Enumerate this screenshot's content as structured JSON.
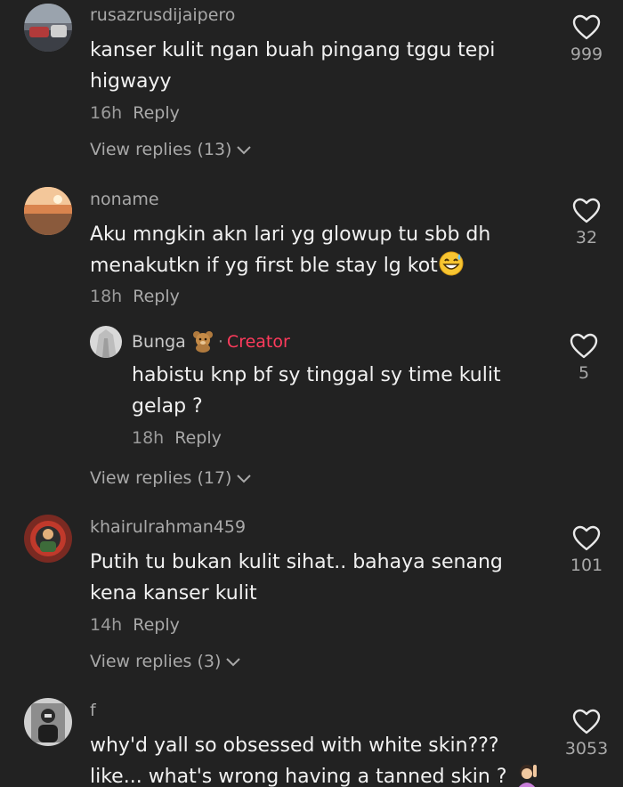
{
  "comments": [
    {
      "username": "rusazrusdijaipero",
      "lines": [
        "kanser kulit ngan buah pingang tggu tepi",
        "higwayy"
      ],
      "time": "16h",
      "reply_label": "Reply",
      "likes": "999",
      "view_replies": "View replies (13)"
    },
    {
      "username": "noname",
      "lines": [
        "Aku mngkin akn lari yg glowup tu sbb dh",
        "menakutkn if yg first ble stay lg kot"
      ],
      "time": "18h",
      "reply_label": "Reply",
      "likes": "32",
      "reply": {
        "username": "Bunga",
        "creator_sep": "·",
        "creator_label": "Creator",
        "lines": [
          "habistu knp bf sy tinggal sy time kulit",
          "gelap ?"
        ],
        "time": "18h",
        "reply_label": "Reply",
        "likes": "5"
      },
      "view_replies": "View replies (17)"
    },
    {
      "username": "khairulrahman459",
      "lines": [
        "Putih tu bukan kulit sihat.. bahaya senang",
        "kena kanser kulit"
      ],
      "time": "14h",
      "reply_label": "Reply",
      "likes": "101",
      "view_replies": "View replies (3)"
    },
    {
      "username": "f",
      "lines": [
        "why'd yall so obsessed with white skin???",
        "like... what's wrong having a tanned skin ?"
      ],
      "likes": "3053"
    }
  ],
  "icons": {
    "heart": "heart-outline-icon",
    "chevron": "chevron-down-icon",
    "sweat_emoji": "grinning-sweat-emoji",
    "bear_emoji": "teddy-bear-emoji",
    "person_emoji": "woman-raising-hand-emoji"
  },
  "colors": {
    "background": "#222222",
    "text": "#f1f1f1",
    "secondary": "#a9a9a9",
    "creator": "#ff3b5c"
  }
}
